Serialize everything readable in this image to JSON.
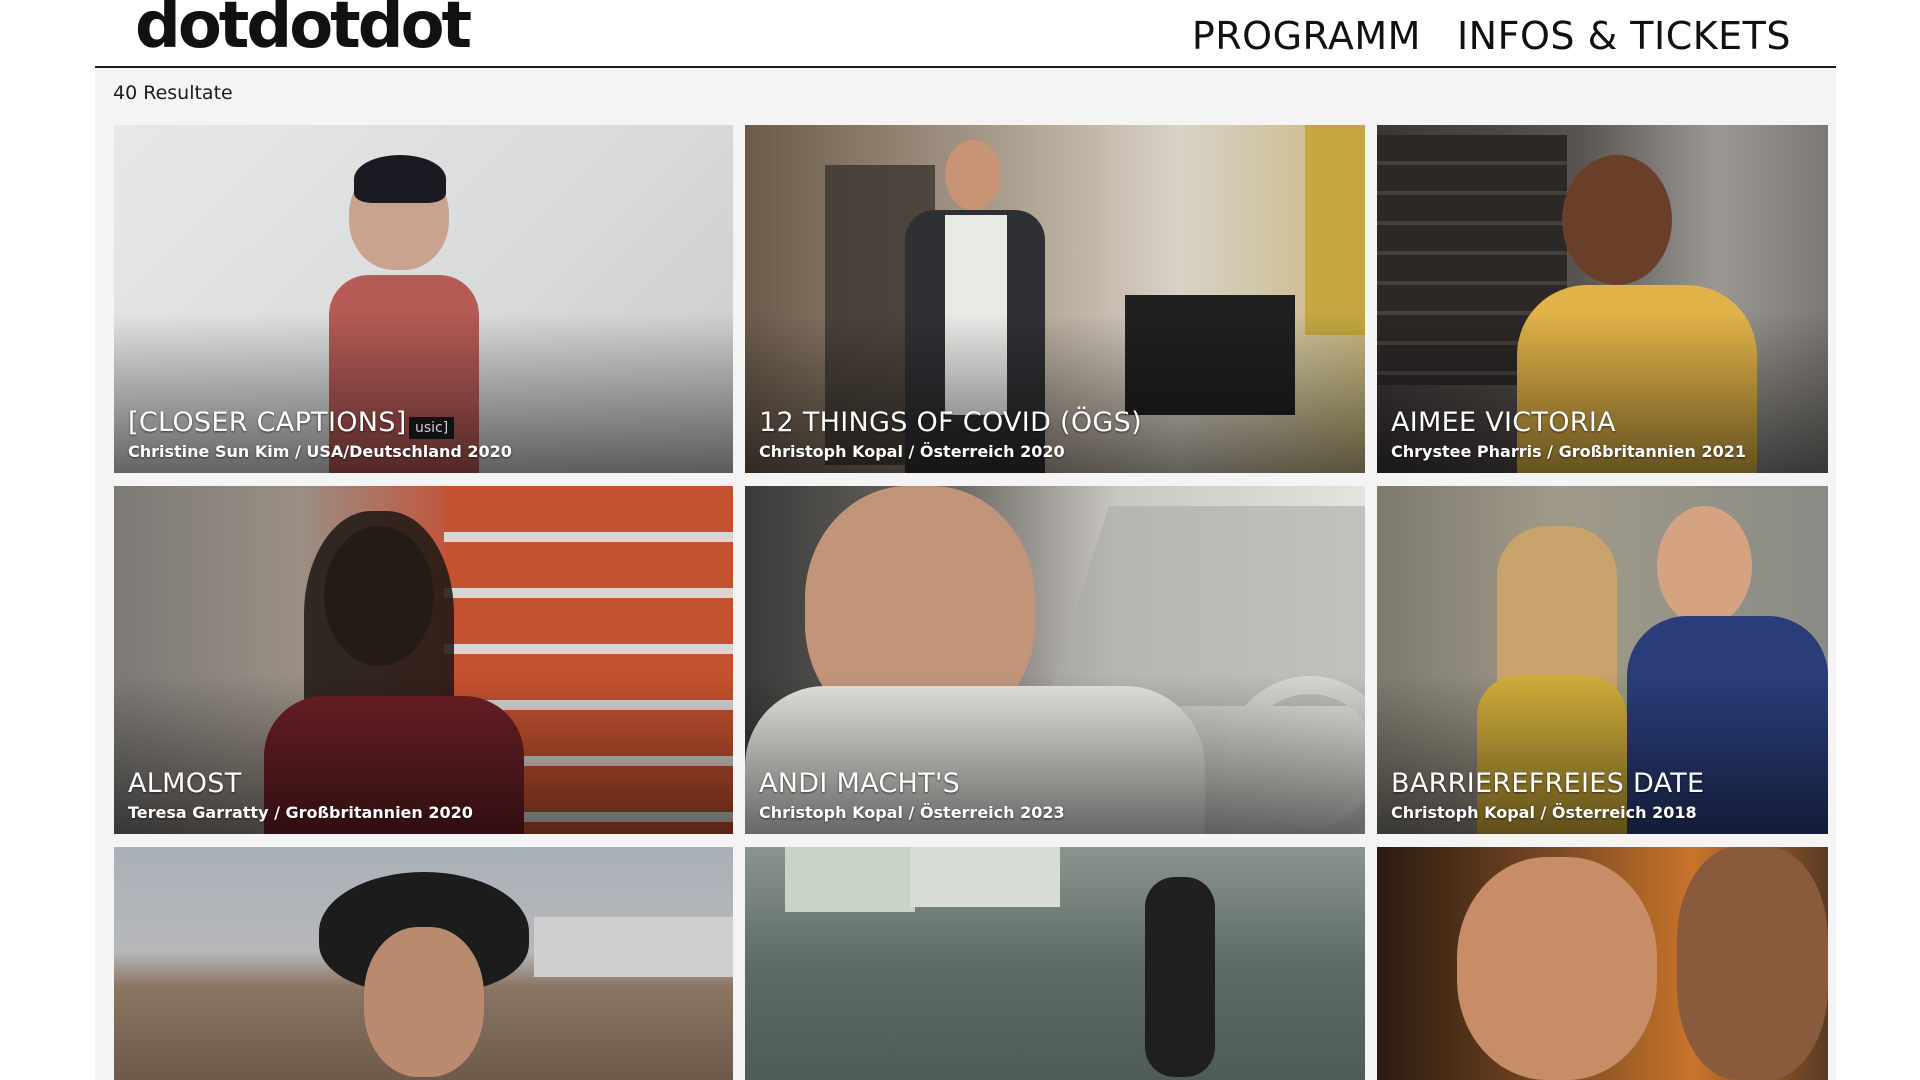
{
  "header": {
    "logo": "dotdotdot",
    "nav": [
      "PROGRAMM",
      "INFOS & TICKETS"
    ]
  },
  "results_label": "40 Resultate",
  "cards": [
    {
      "title": "[CLOSER CAPTIONS]",
      "subtitle": "Christine Sun Kim / USA/Deutschland 2020",
      "overlay_caption": "usic]"
    },
    {
      "title": "12 THINGS OF COVID (ÖGS)",
      "subtitle": "Christoph Kopal / Österreich 2020"
    },
    {
      "title": "AIMEE VICTORIA",
      "subtitle": "Chrystee Pharris / Großbritannien 2021"
    },
    {
      "title": "ALMOST",
      "subtitle": "Teresa Garratty / Großbritannien 2020"
    },
    {
      "title": "ANDI MACHT'S",
      "subtitle": "Christoph Kopal / Österreich 2023"
    },
    {
      "title": "BARRIEREFREIES DATE",
      "subtitle": "Christoph Kopal / Österreich 2018"
    },
    {
      "title": "",
      "subtitle": ""
    },
    {
      "title": "",
      "subtitle": ""
    },
    {
      "title": "",
      "subtitle": ""
    }
  ]
}
